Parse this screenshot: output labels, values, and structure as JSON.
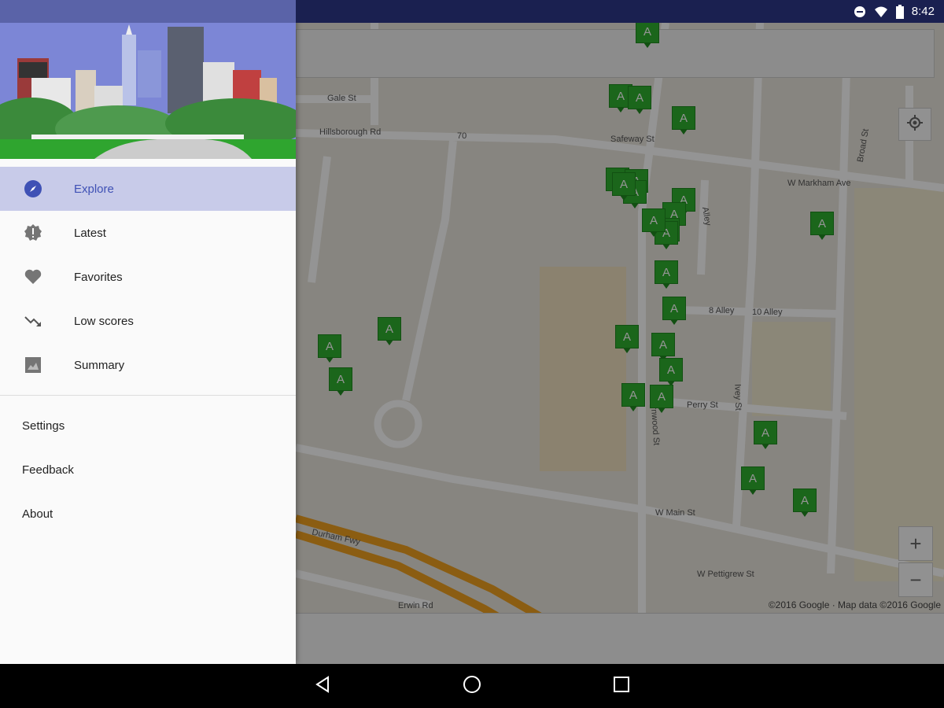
{
  "status_bar": {
    "time": "8:42",
    "icons": [
      "do-not-disturb-icon",
      "wifi-icon",
      "battery-icon"
    ]
  },
  "drawer": {
    "nav_items": [
      {
        "label": "Explore",
        "icon": "compass-icon",
        "active": true
      },
      {
        "label": "Latest",
        "icon": "new-badge-icon",
        "active": false
      },
      {
        "label": "Favorites",
        "icon": "heart-icon",
        "active": false
      },
      {
        "label": "Low scores",
        "icon": "trending-down-icon",
        "active": false
      },
      {
        "label": "Summary",
        "icon": "chart-icon",
        "active": false
      }
    ],
    "secondary_items": [
      {
        "label": "Settings"
      },
      {
        "label": "Feedback"
      },
      {
        "label": "About"
      }
    ]
  },
  "map": {
    "streets": [
      "Gale St",
      "Hillsborough Rd",
      "Safeway St",
      "W Markham Ave",
      "Broad St",
      "Alley",
      "8 Alley",
      "10 Alley",
      "Ivey St",
      "Perry St",
      "Fernwood St",
      "W Main St",
      "W Pettigrew St",
      "Erwin Rd",
      "70",
      "Durham Fwy"
    ],
    "marker_label": "A",
    "markers_count": 27,
    "attribution": "©2016 Google · Map data ©2016 Google",
    "controls": {
      "zoom_in": "+",
      "zoom_out": "−"
    }
  },
  "colors": {
    "accent": "#3f51b5",
    "active_bg": "#c8cbe9",
    "marker_green": "#30b030",
    "status_bar": "#1a2050"
  }
}
